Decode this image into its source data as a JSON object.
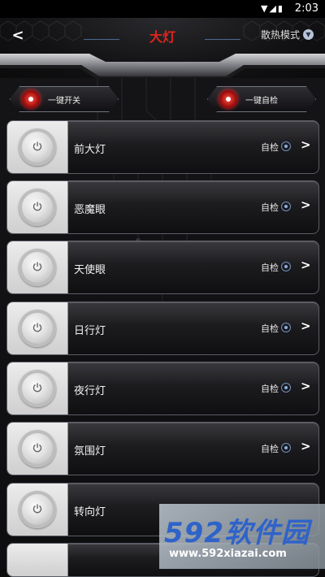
{
  "status_bar": {
    "time": "2:03",
    "icons": [
      "wifi-icon",
      "signal-icon",
      "battery-icon"
    ]
  },
  "header": {
    "title": "大灯",
    "back_icon": "chevron-left-icon",
    "cooling_mode_label": "散热模式",
    "cooling_mode_icon": "chevron-down-icon",
    "title_color": "#e0241b"
  },
  "actions": {
    "one_key_switch": "一键开关",
    "one_key_check": "一键自检"
  },
  "lights": [
    {
      "name": "前大灯",
      "check": "自检"
    },
    {
      "name": "恶魔眼",
      "check": "自检"
    },
    {
      "name": "天使眼",
      "check": "自检"
    },
    {
      "name": "日行灯",
      "check": "自检"
    },
    {
      "name": "夜行灯",
      "check": "自检"
    },
    {
      "name": "氛围灯",
      "check": "自检"
    },
    {
      "name": "转向灯",
      "check": ""
    }
  ],
  "watermark": {
    "brand": "592软件园",
    "url": "www.592xiazai.com"
  }
}
